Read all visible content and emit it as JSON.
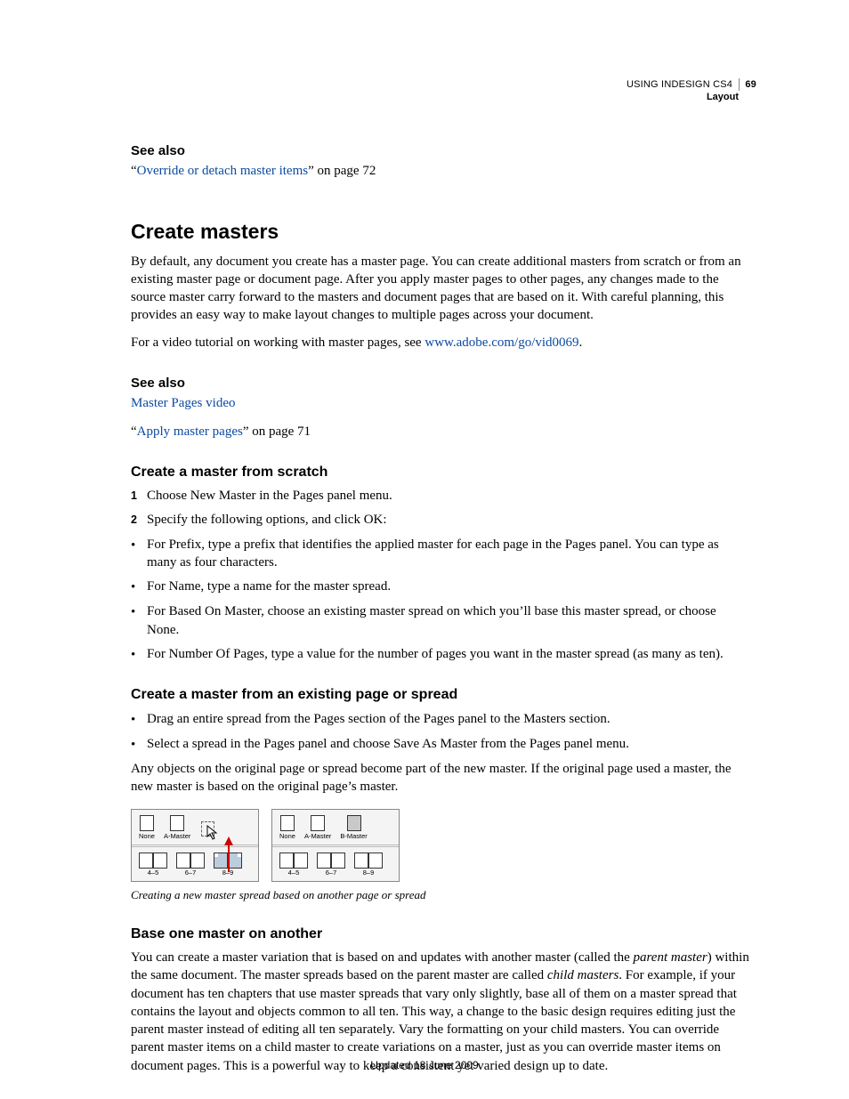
{
  "header": {
    "doc_title": "USING INDESIGN CS4",
    "section": "Layout",
    "page_number": "69"
  },
  "see_also_1": {
    "heading": "See also",
    "q_open": "“",
    "link": "Override or detach master items",
    "suffix": "” on page 72"
  },
  "h1": "Create masters",
  "intro_p1": "By default, any document you create has a master page. You can create additional masters from scratch or from an existing master page or document page. After you apply master pages to other pages, any changes made to the source master carry forward to the masters and document pages that are based on it. With careful planning, this provides an easy way to make layout changes to multiple pages across your document.",
  "intro_p2_pre": "For a video tutorial on working with master pages, see ",
  "intro_p2_link": "www.adobe.com/go/vid0069",
  "intro_p2_post": ".",
  "see_also_2": {
    "heading": "See also",
    "link1": "Master Pages video",
    "q_open": "“",
    "link2": "Apply master pages",
    "suffix": "” on page 71"
  },
  "s1": {
    "heading": "Create a master from scratch",
    "step1": "Choose New Master in the Pages panel menu.",
    "step2": "Specify the following options, and click OK:",
    "b1": "For Prefix, type a prefix that identifies the applied master for each page in the Pages panel. You can type as many as four characters.",
    "b2": "For Name, type a name for the master spread.",
    "b3": "For Based On Master, choose an existing master spread on which you’ll base this master spread, or choose None.",
    "b4": "For Number Of Pages, type a value for the number of pages you want in the master spread (as many as ten)."
  },
  "s2": {
    "heading": "Create a master from an existing page or spread",
    "b1": "Drag an entire spread from the Pages section of the Pages panel to the Masters section.",
    "b2": "Select a spread in the Pages panel and choose Save As Master from the Pages panel menu.",
    "p_after": "Any objects on the original page or spread become part of the new master. If the original page used a master, the new master is based on the original page’s master.",
    "caption": "Creating a new master spread based on another page or spread"
  },
  "figure": {
    "left": {
      "masters": [
        "None",
        "A-Master"
      ],
      "spreads": [
        "4–5",
        "6–7",
        "8–9"
      ]
    },
    "right": {
      "masters": [
        "None",
        "A-Master",
        "B-Master"
      ],
      "spreads": [
        "4–5",
        "6–7",
        "8–9"
      ]
    }
  },
  "s3": {
    "heading": "Base one master on another",
    "p_a": "You can create a master variation that is based on and updates with another master (called the ",
    "em1": "parent master",
    "p_b": ") within the same document. The master spreads based on the parent master are called ",
    "em2": "child masters",
    "p_c": ". For example, if your document has ten chapters that use master spreads that vary only slightly, base all of them on a master spread that contains the layout and objects common to all ten. This way, a change to the basic design requires editing just the parent master instead of editing all ten separately. Vary the formatting on your child masters. You can override parent master items on a child master to create variations on a master, just as you can override master items on document pages. This is a powerful way to keep a consistent yet varied design up to date."
  },
  "footer": "Updated 18 June 2009"
}
